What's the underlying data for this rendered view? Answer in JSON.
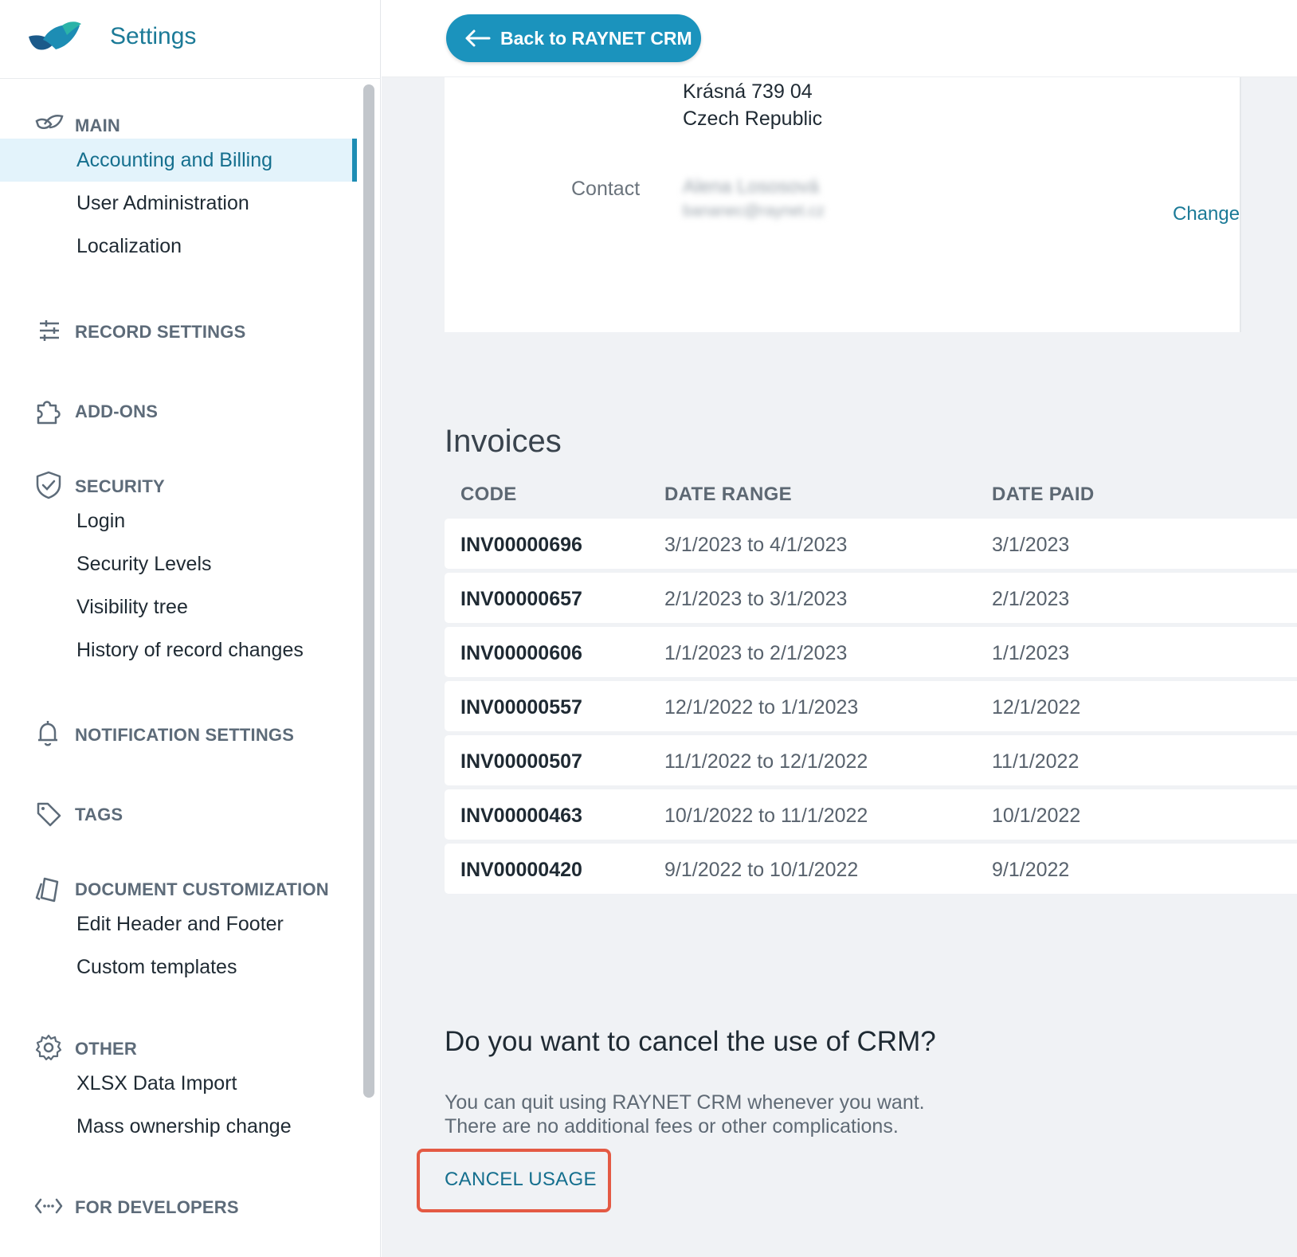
{
  "app": {
    "title": "Settings"
  },
  "topbar": {
    "back_label": "Back to RAYNET CRM"
  },
  "sidebar": {
    "sections": [
      {
        "label": "MAIN",
        "icon": "ray-logo-icon",
        "items": [
          "Accounting and Billing",
          "User Administration",
          "Localization"
        ],
        "active": "Accounting and Billing"
      },
      {
        "label": "RECORD SETTINGS",
        "icon": "sliders-icon",
        "items": []
      },
      {
        "label": "ADD-ONS",
        "icon": "puzzle-icon",
        "items": []
      },
      {
        "label": "SECURITY",
        "icon": "shield-check-icon",
        "items": [
          "Login",
          "Security Levels",
          "Visibility tree",
          "History of record changes"
        ]
      },
      {
        "label": "NOTIFICATION SETTINGS",
        "icon": "bell-icon",
        "items": []
      },
      {
        "label": "TAGS",
        "icon": "tag-icon",
        "items": []
      },
      {
        "label": "DOCUMENT CUSTOMIZATION",
        "icon": "document-pages-icon",
        "items": [
          "Edit Header and Footer",
          "Custom templates"
        ]
      },
      {
        "label": "OTHER",
        "icon": "gear-icon",
        "items": [
          "XLSX Data Import",
          "Mass ownership change"
        ]
      },
      {
        "label": "FOR DEVELOPERS",
        "icon": "code-icon",
        "items": []
      }
    ]
  },
  "billing": {
    "address_line1": "Krásná 739 04",
    "address_line2": "Czech Republic",
    "contact_label": "Contact",
    "contact_name": "Alena Lososová",
    "contact_email": "bananec@raynet.cz",
    "change_label": "Change"
  },
  "invoices": {
    "title": "Invoices",
    "columns": [
      "CODE",
      "DATE RANGE",
      "DATE PAID"
    ],
    "rows": [
      [
        "INV00000696",
        "3/1/2023 to 4/1/2023",
        "3/1/2023"
      ],
      [
        "INV00000657",
        "2/1/2023 to 3/1/2023",
        "2/1/2023"
      ],
      [
        "INV00000606",
        "1/1/2023 to 2/1/2023",
        "1/1/2023"
      ],
      [
        "INV00000557",
        "12/1/2022 to 1/1/2023",
        "12/1/2022"
      ],
      [
        "INV00000507",
        "11/1/2022 to 12/1/2022",
        "11/1/2022"
      ],
      [
        "INV00000463",
        "10/1/2022 to 11/1/2022",
        "10/1/2022"
      ],
      [
        "INV00000420",
        "9/1/2022 to 10/1/2022",
        "9/1/2022"
      ]
    ]
  },
  "cancel": {
    "title": "Do you want to cancel the use of CRM?",
    "text_line1": "You can quit using RAYNET CRM whenever you want.",
    "text_line2": "There are no additional fees or other complications.",
    "button_label": "CANCEL USAGE",
    "highlight_color": "#e45a44"
  },
  "colors": {
    "accent": "#1b93bd",
    "brand_text": "#1b7a97",
    "active_bg": "#e3f3fb"
  }
}
